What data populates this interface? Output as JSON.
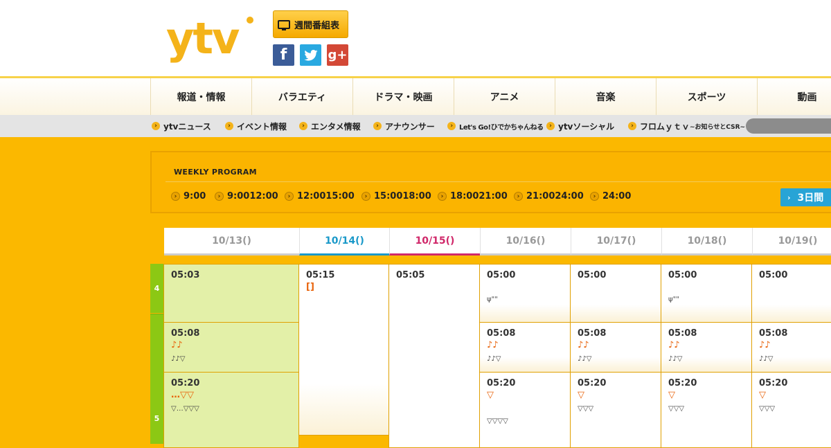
{
  "logo": {
    "text": "ytv"
  },
  "header": {
    "weekly_button": "週間番組表",
    "facebook": "f",
    "twitter": "t",
    "googleplus": "g+"
  },
  "gnav": [
    "報道・情報",
    "バラエティ",
    "ドラマ・映画",
    "アニメ",
    "音楽",
    "スポーツ",
    "動画"
  ],
  "snav": [
    {
      "label": "ytvニュース"
    },
    {
      "label": "イベント情報"
    },
    {
      "label": "エンタメ情報"
    },
    {
      "label": "アナウンサー"
    },
    {
      "label": "Let's Go!ひでかちゃんねる"
    },
    {
      "label": "ytvソーシャル"
    },
    {
      "label": "フロムｙｔｖ",
      "small": "~お知らせとCSR~"
    }
  ],
  "weekly": {
    "title": "WEEKLY PROGRAM",
    "slots": [
      "9:00",
      "9:0012:00",
      "12:0015:00",
      "15:0018:00",
      "18:0021:00",
      "21:0024:00",
      "24:00"
    ],
    "three_days": "3日間"
  },
  "days": [
    {
      "label": "10/13()"
    },
    {
      "label": "10/14()"
    },
    {
      "label": "10/15()"
    },
    {
      "label": "10/16()"
    },
    {
      "label": "10/17()"
    },
    {
      "label": "10/18()"
    },
    {
      "label": "10/19()"
    }
  ],
  "hours": [
    "4",
    "5"
  ],
  "programs": {
    "d13_1": {
      "time": "05:03"
    },
    "d13_2": {
      "time": "05:08",
      "title": "♪♪",
      "desc": "♪♪▽"
    },
    "d13_3": {
      "time": "05:20",
      "title": "…▽▽",
      "desc": "▽…▽▽▽"
    },
    "d14_1": {
      "time": "05:15",
      "title": "[]"
    },
    "d15_1": {
      "time": "05:05"
    },
    "d16_1": {
      "time": "05:00",
      "desc": "ψ\"\""
    },
    "d16_2": {
      "time": "05:08",
      "title": "♪♪",
      "desc": "♪♪▽"
    },
    "d16_3": {
      "time": "05:20",
      "title": "▽",
      "desc": "▽▽▽▽"
    },
    "d17_1": {
      "time": "05:00"
    },
    "d17_2": {
      "time": "05:08",
      "title": "♪♪",
      "desc": "♪♪▽"
    },
    "d17_3": {
      "time": "05:20",
      "title": "▽",
      "desc": "▽▽▽"
    },
    "d18_1": {
      "time": "05:00",
      "desc": "ψ\"\""
    },
    "d18_2": {
      "time": "05:08",
      "title": "♪♪",
      "desc": "♪♪▽"
    },
    "d18_3": {
      "time": "05:20",
      "title": "▽",
      "desc": "▽▽▽"
    },
    "d19_1": {
      "time": "05:00"
    },
    "d19_2": {
      "time": "05:08",
      "title": "♪♪",
      "desc": "♪♪▽"
    },
    "d19_3": {
      "time": "05:20",
      "title": "▽",
      "desc": "▽▽▽"
    }
  }
}
